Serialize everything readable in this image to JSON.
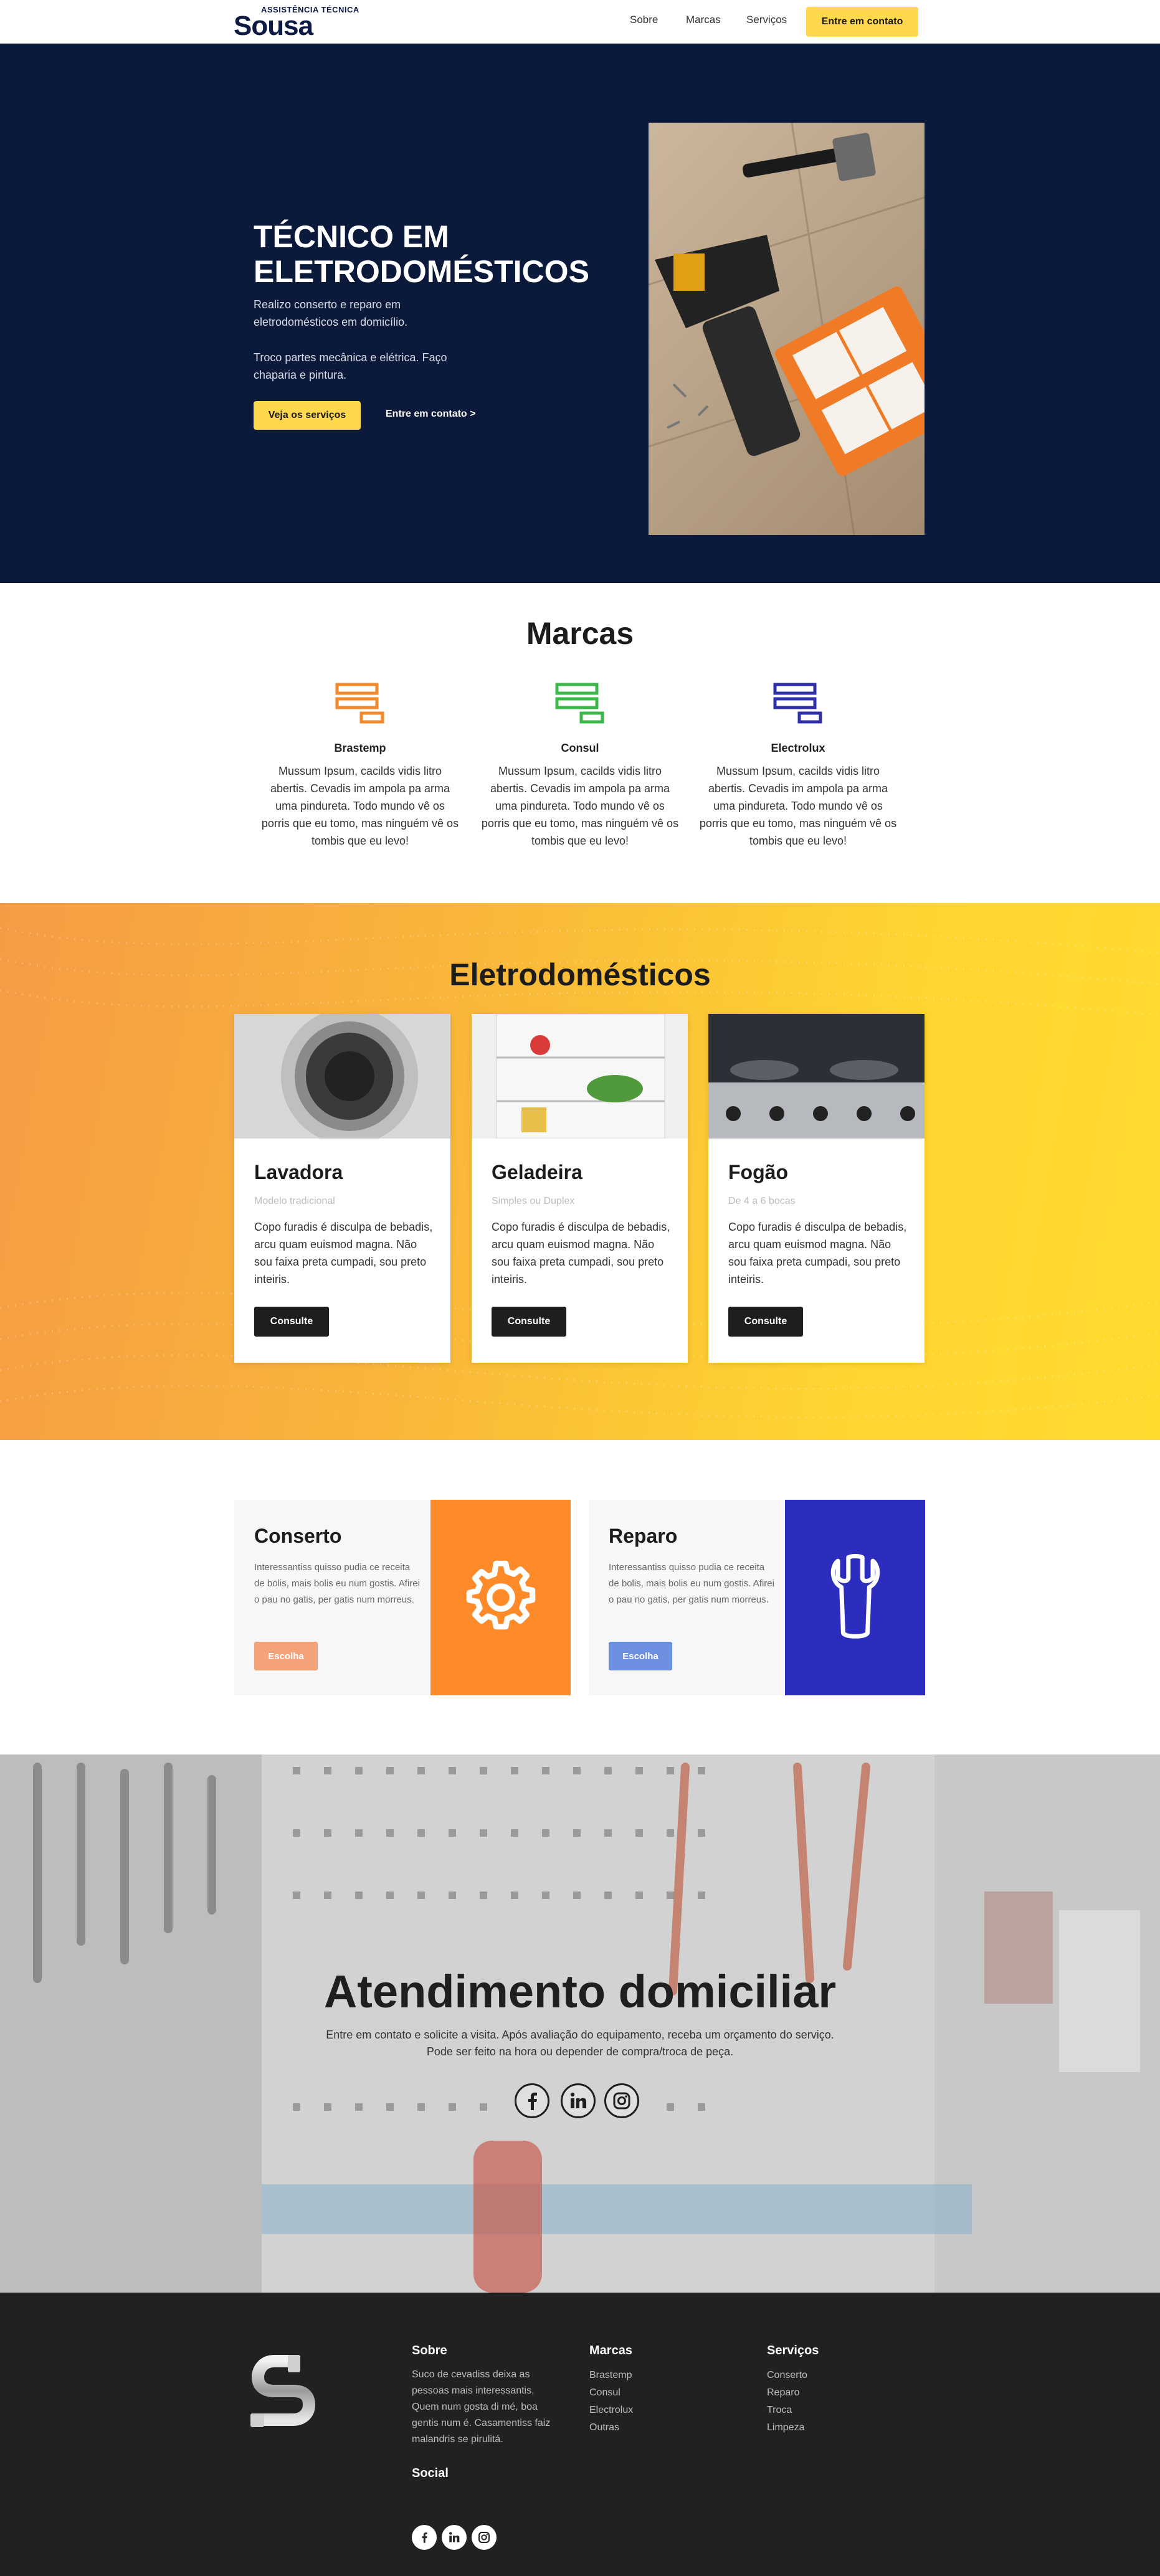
{
  "header": {
    "logo_small": "ASSISTÊNCIA TÉCNICA",
    "logo_big": "Sousa",
    "nav": [
      "Sobre",
      "Marcas",
      "Serviços"
    ],
    "cta": "Entre em contato"
  },
  "hero": {
    "title": "TÉCNICO EM ELETRODOMÉSTICOS",
    "p1": "Realizo conserto e reparo em eletrodomésticos em domicílio.",
    "p2": "Troco partes mecânica e elétrica. Faço chaparia e pintura.",
    "btn_primary": "Veja os serviços",
    "btn_secondary": "Entre em contato >"
  },
  "marcas": {
    "title": "Marcas",
    "items": [
      {
        "name": "Brastemp",
        "text": "Mussum Ipsum, cacilds vidis litro abertis. Cevadis im ampola pa arma uma pindureta. Todo mundo vê os porris que eu tomo, mas ninguém vê os tombis que eu levo!",
        "color": "#f08a2c"
      },
      {
        "name": "Consul",
        "text": "Mussum Ipsum, cacilds vidis litro abertis. Cevadis im ampola pa arma uma pindureta. Todo mundo vê os porris que eu tomo, mas ninguém vê os tombis que eu levo!",
        "color": "#3cb84a"
      },
      {
        "name": "Electrolux",
        "text": "Mussum Ipsum, cacilds vidis litro abertis. Cevadis im ampola pa arma uma pindureta. Todo mundo vê os porris que eu tomo, mas ninguém vê os tombis que eu levo!",
        "color": "#2f2fa8"
      }
    ]
  },
  "eletro": {
    "title": "Eletrodomésticos",
    "cards": [
      {
        "title": "Lavadora",
        "sub": "Modelo tradicional",
        "text": "Copo furadis é disculpa de bebadis, arcu quam euismod magna. Não sou faixa preta cumpadi, sou preto inteiris.",
        "btn": "Consulte"
      },
      {
        "title": "Geladeira",
        "sub": "Simples ou Duplex",
        "text": "Copo furadis é disculpa de bebadis, arcu quam euismod magna. Não sou faixa preta cumpadi, sou preto inteiris.",
        "btn": "Consulte"
      },
      {
        "title": "Fogão",
        "sub": "De 4 a 6 bocas",
        "text": "Copo furadis é disculpa de bebadis, arcu quam euismod magna. Não sou faixa preta cumpadi, sou preto inteiris.",
        "btn": "Consulte"
      }
    ]
  },
  "servicos": [
    {
      "title": "Conserto",
      "text": "Interessantiss quisso pudia ce receita de bolis, mais bolis eu num gostis. Afirei o pau no gatis, per gatis num morreus.",
      "btn": "Escolha",
      "btn_color": "#f4a27a",
      "panel_color": "#ff8a2a",
      "icon": "gear-icon"
    },
    {
      "title": "Reparo",
      "text": "Interessantiss quisso pudia ce receita de bolis, mais bolis eu num gostis. Afirei o pau no gatis, per gatis num morreus.",
      "btn": "Escolha",
      "btn_color": "#6d8fe0",
      "panel_color": "#2c2cbf",
      "icon": "wrench-icon"
    }
  ],
  "atendimento": {
    "title": "Atendimento domiciliar",
    "line1": "Entre em contato e solicite a visita. Após avaliação do equipamento, receba um orçamento do serviço.",
    "line2": "Pode ser feito na hora ou depender de compra/troca de peça.",
    "social": [
      "facebook-icon",
      "linkedin-icon",
      "instagram-icon"
    ]
  },
  "footer": {
    "sobre": {
      "title": "Sobre",
      "text": "Suco de cevadiss deixa as pessoas mais interessantis. Quem num gosta di mé, boa gentis num é. Casamentiss faiz malandris se pirulitá."
    },
    "social_title": "Social",
    "marcas": {
      "title": "Marcas",
      "items": [
        "Brastemp",
        "Consul",
        "Electrolux",
        "Outras"
      ]
    },
    "servicos": {
      "title": "Serviços",
      "items": [
        "Conserto",
        "Reparo",
        "Troca",
        "Limpeza"
      ]
    }
  }
}
